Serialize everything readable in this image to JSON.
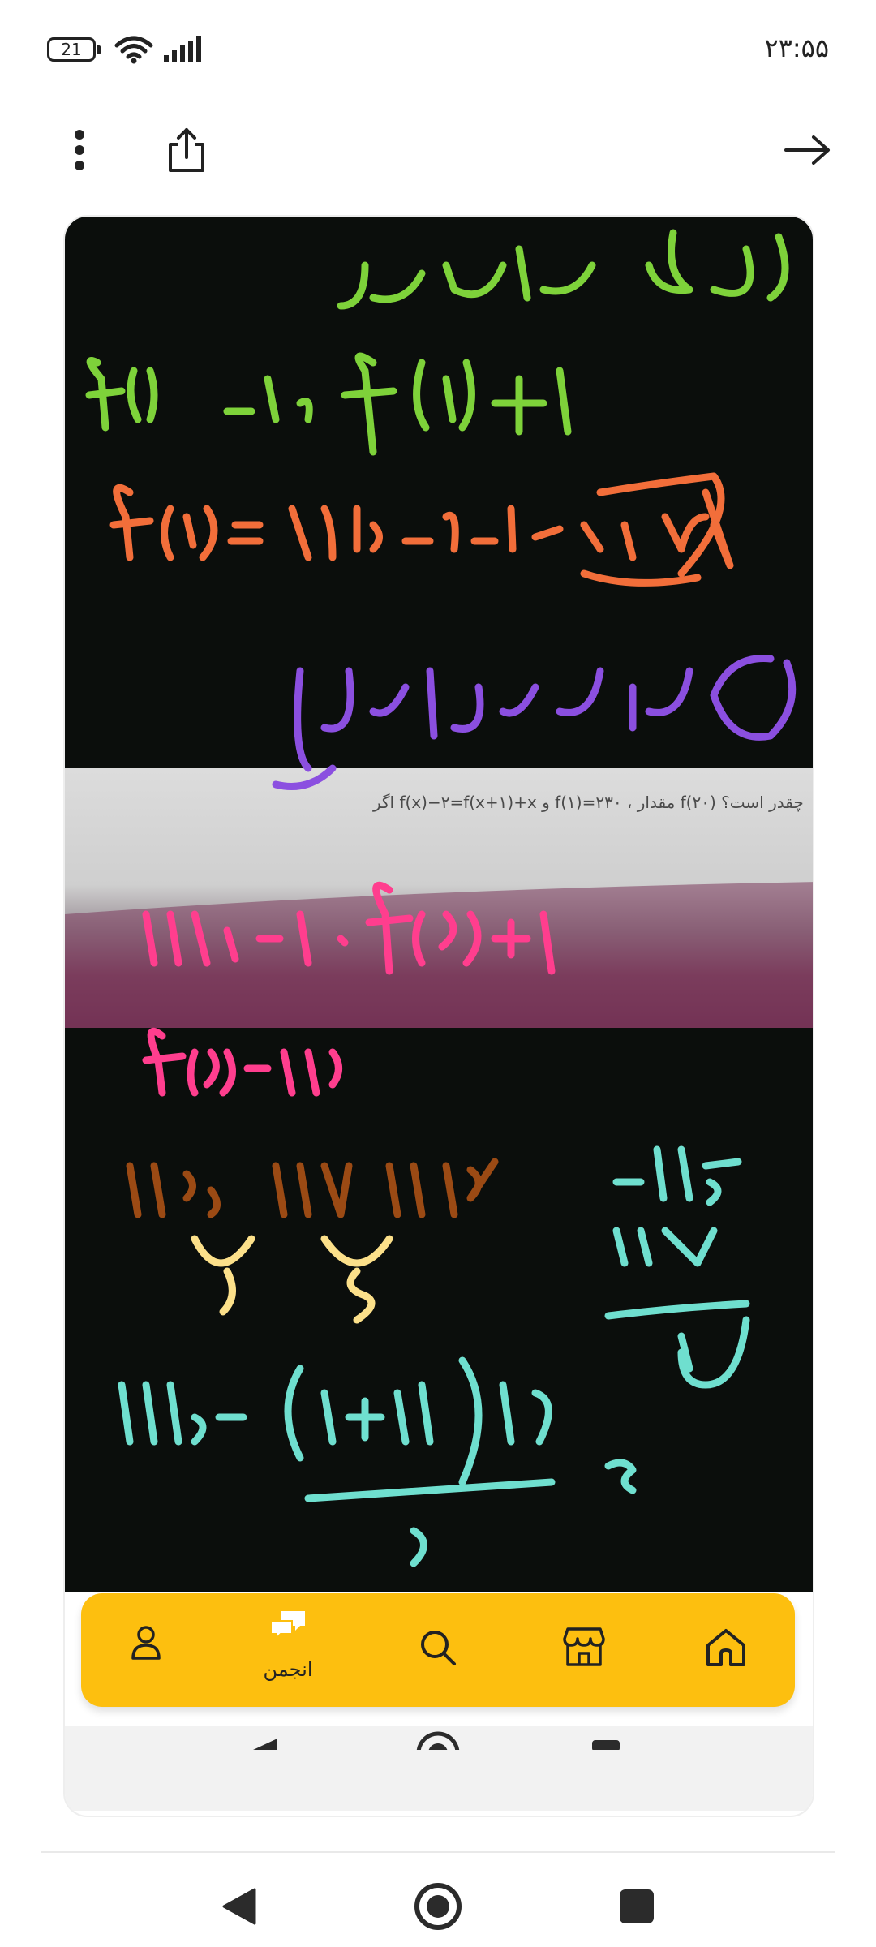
{
  "status_bar": {
    "time": "۲۳:۵۵",
    "battery_level": "21",
    "wifi_icon": "wifi-icon",
    "signal_icon": "signal-bars-icon"
  },
  "toolbar": {
    "more_icon": "more-vertical-icon",
    "share_icon": "share-icon",
    "back_icon": "arrow-right-icon"
  },
  "post": {
    "image_description": "handwritten math solution over a photo of a textbook problem",
    "photo_question": "اگر f(x)−۲=f(x+۱)+x و f(۱)=۲۳۰ ، مقدار f(۲۰) چقدر است؟"
  },
  "bottom_nav": {
    "active_color": "#fdbf0f",
    "items": [
      {
        "icon": "profile-icon",
        "label": ""
      },
      {
        "icon": "forum-icon",
        "label": "انجمن"
      },
      {
        "icon": "search-icon",
        "label": ""
      },
      {
        "icon": "store-icon",
        "label": ""
      },
      {
        "icon": "home-icon",
        "label": ""
      }
    ]
  },
  "system_nav": {
    "back_icon": "triangle-back-icon",
    "home_icon": "circle-home-icon",
    "recents_icon": "square-recents-icon"
  }
}
